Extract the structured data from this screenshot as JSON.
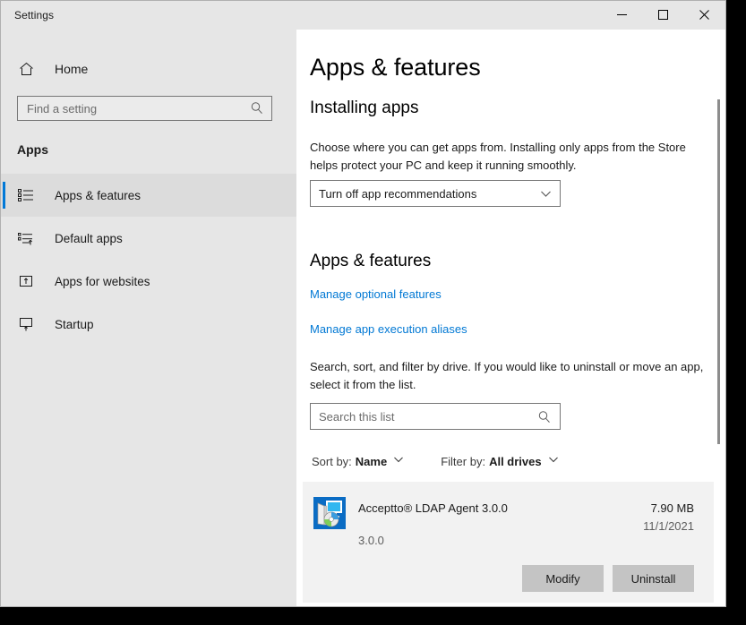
{
  "window": {
    "title": "Settings",
    "controls": {
      "minimize": "minimize-button",
      "maximize": "maximize-button",
      "close": "close-button"
    }
  },
  "sidebar": {
    "home": {
      "label": "Home",
      "icon": "home-icon"
    },
    "search": {
      "placeholder": "Find a setting",
      "value": "",
      "icon": "search-icon"
    },
    "category": "Apps",
    "items": [
      {
        "label": "Apps & features",
        "icon": "list-bullets-icon",
        "selected": true
      },
      {
        "label": "Default apps",
        "icon": "list-default-icon",
        "selected": false
      },
      {
        "label": "Apps for websites",
        "icon": "box-arrow-up-icon",
        "selected": false
      },
      {
        "label": "Startup",
        "icon": "monitor-arrow-up-icon",
        "selected": false
      }
    ]
  },
  "main": {
    "page_title": "Apps & features",
    "installing": {
      "heading": "Installing apps",
      "description": "Choose where you can get apps from. Installing only apps from the Store helps protect your PC and keep it running smoothly.",
      "dropdown_value": "Turn off app recommendations"
    },
    "apps_features": {
      "heading": "Apps & features",
      "links": [
        "Manage optional features",
        "Manage app execution aliases"
      ],
      "description": "Search, sort, and filter by drive. If you would like to uninstall or move an app, select it from the list.",
      "search": {
        "placeholder": "Search this list",
        "value": "",
        "icon": "search-icon"
      },
      "sort": {
        "label": "Sort by:",
        "value": "Name"
      },
      "filter": {
        "label": "Filter by:",
        "value": "All drives"
      }
    },
    "app_list": [
      {
        "name": "Acceptto® LDAP Agent 3.0.0",
        "version": "3.0.0",
        "size": "7.90 MB",
        "date": "11/1/2021",
        "icon": "app-monitor-disc-icon",
        "buttons": {
          "modify": "Modify",
          "uninstall": "Uninstall"
        }
      }
    ]
  },
  "colors": {
    "accent": "#0078d7",
    "link": "#0078d4",
    "sidebar_bg": "#e6e6e6",
    "panel_bg": "#ffffff",
    "row_bg": "#f2f2f2",
    "button_bg": "#c4c4c4"
  }
}
